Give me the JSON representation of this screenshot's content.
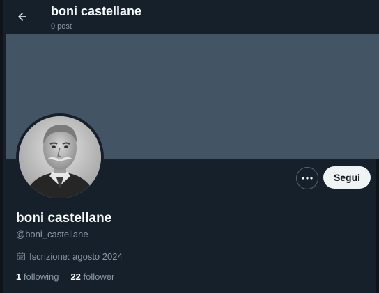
{
  "header": {
    "title": "boni castellane",
    "post_count": "0 post",
    "back_icon": "arrow-left-icon"
  },
  "banner": {
    "color": "#435464"
  },
  "profile": {
    "display_name": "boni castellane",
    "handle": "@boni_castellane",
    "joined": "Iscrizione: agosto 2024",
    "calendar_icon": "calendar-icon",
    "avatar": "profile-photo"
  },
  "actions": {
    "more_icon": "more-dots-icon",
    "follow_label": "Segui"
  },
  "stats": {
    "following_count": "1",
    "following_label": "following",
    "followers_count": "22",
    "followers_label": "follower"
  },
  "colors": {
    "background": "#15202b",
    "text_primary": "#f7f9f9",
    "text_secondary": "#8b98a5",
    "follow_button_bg": "#eff3f4"
  }
}
